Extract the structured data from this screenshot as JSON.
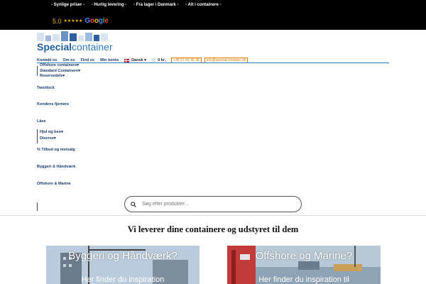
{
  "topbar": {
    "usps": [
      "- Synlige priser -",
      "- Hurtig levering -",
      "- Fra lager i Danmark -",
      "- Alt i containere -"
    ],
    "rating_score": "5.0",
    "rating_stars": "★★★★★",
    "google_letters": [
      "G",
      "o",
      "o",
      "g",
      "l",
      "e"
    ]
  },
  "logo": {
    "brand_bold": "Special",
    "brand_light": "container"
  },
  "nav": {
    "links": [
      "Kontakt os",
      "Om os",
      "Find os",
      "Min konto"
    ],
    "language": "Dansk",
    "cart": "0 kr.",
    "phone": "+45 22 66 46 38",
    "email": "info@specialcontainer.dk"
  },
  "menu": {
    "offshore": "Offshore containere",
    "standard": "Standard Containere",
    "reservedele": "Reservedele",
    "twistlock": "Twistlock",
    "kondens": "Kondens fjernere",
    "laase": "Låse",
    "hjul": "Hjul og ben",
    "diverse": "Diverse",
    "tilbud": "% Tilbud og restsalg",
    "byggeri": "Byggeri & Håndværk",
    "offshore_marine": "Offshore & Marine"
  },
  "search": {
    "placeholder": "Søg efter produkter..."
  },
  "headline": "Vi leverer dine containere og udstyret til dem",
  "cards": {
    "left_title": "Byggeri og Håndværk?",
    "left_sub": "Her finder du inspiration",
    "right_title": "Offshore og Marine?",
    "right_sub": "Her finder du inspiration til"
  }
}
